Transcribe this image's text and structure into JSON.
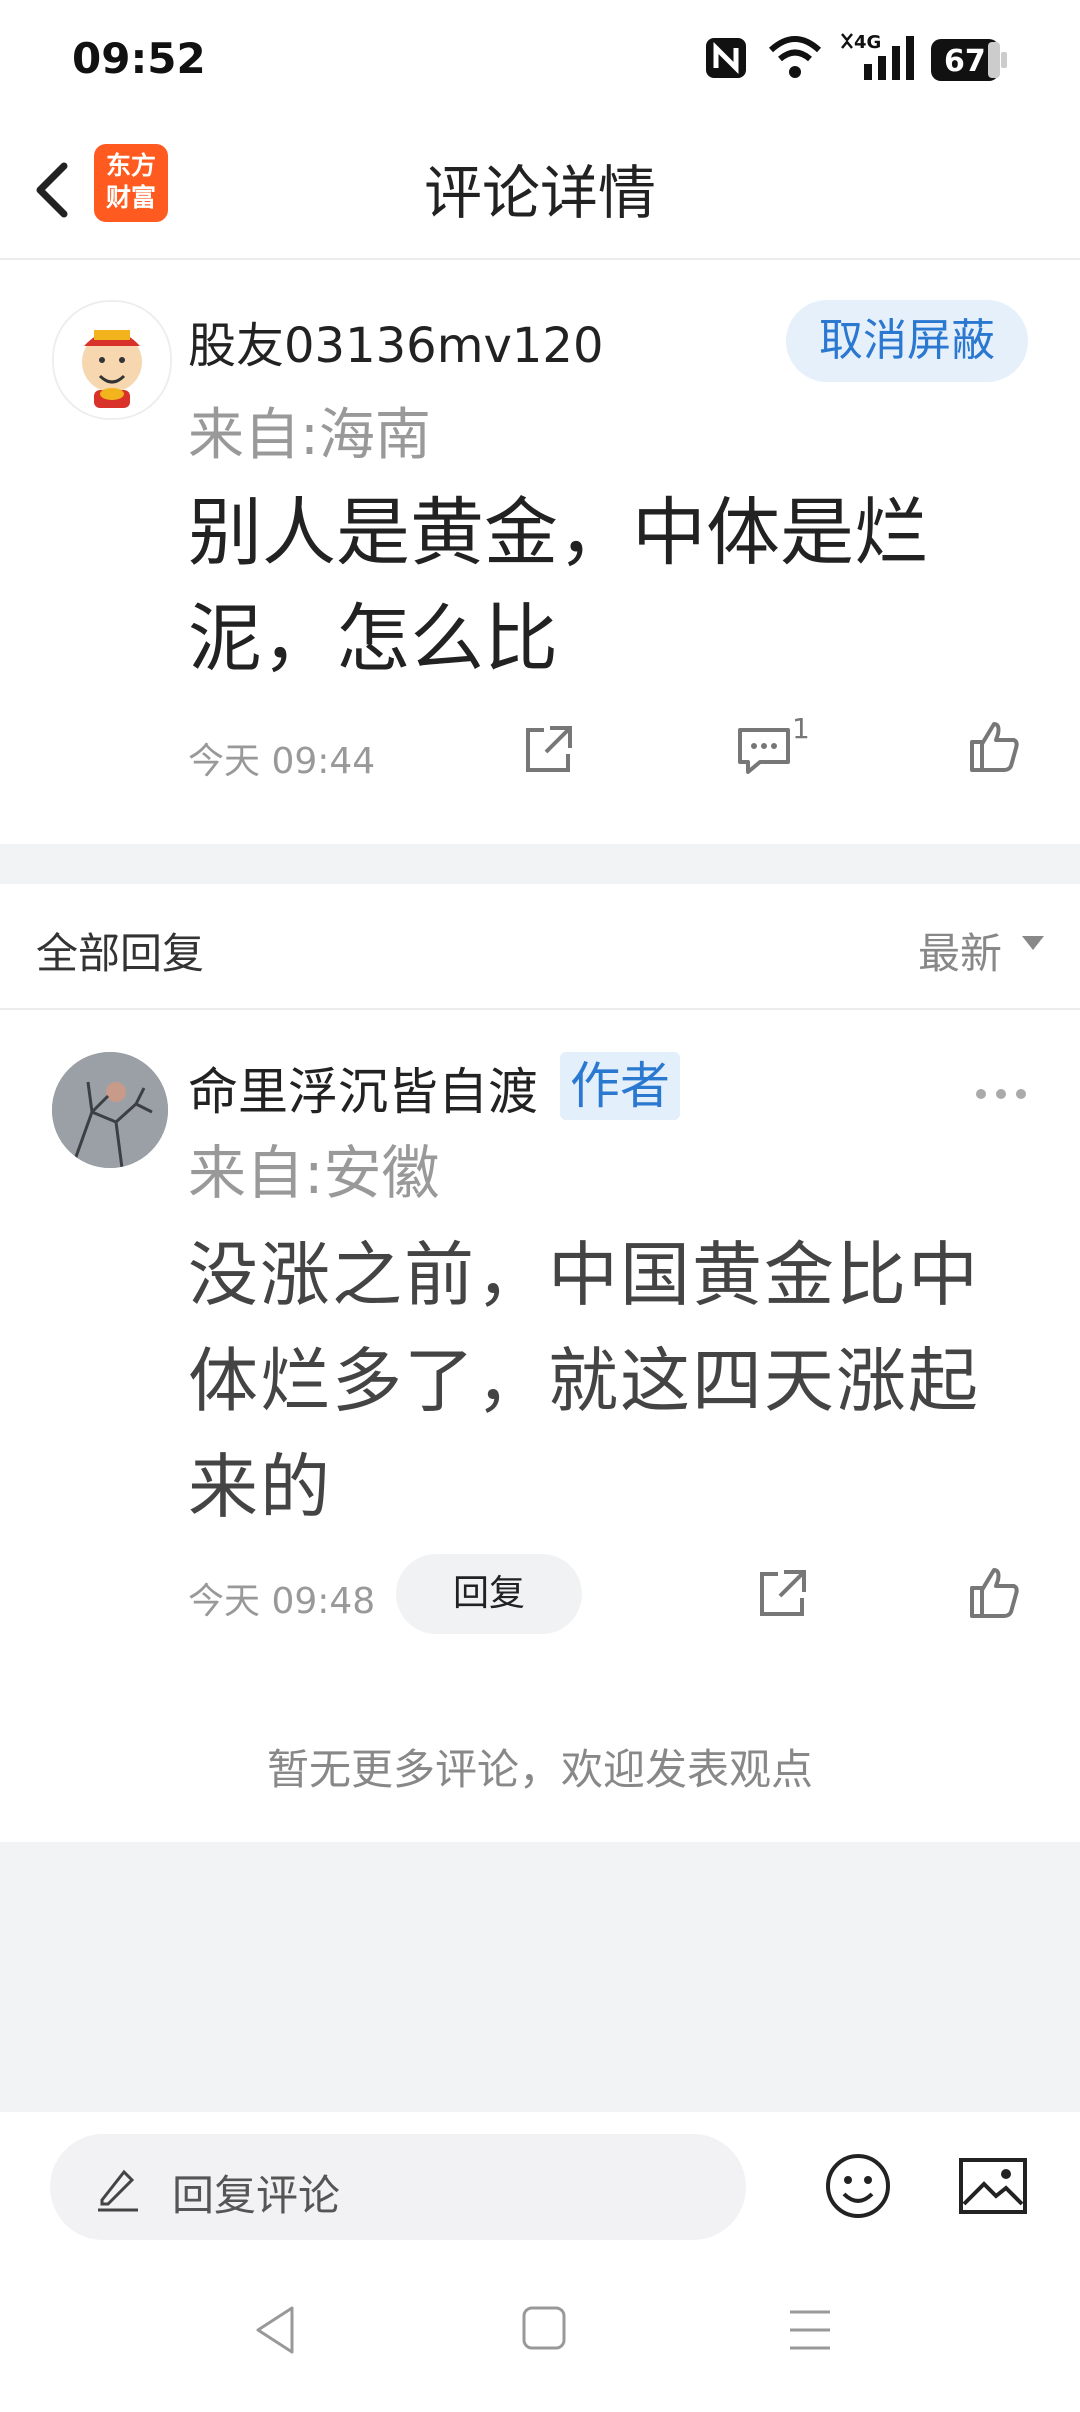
{
  "status_bar": {
    "time": "09:52",
    "icons": [
      "nfc-icon",
      "wifi-icon",
      "signal-4g-icon",
      "battery-icon"
    ],
    "battery": "67"
  },
  "nav": {
    "back_icon": "chevron-left-icon",
    "logo_text_line1": "东方",
    "logo_text_line2": "财富",
    "title": "评论详情"
  },
  "main_comment": {
    "username": "股友03136mv120",
    "from": "来自:海南",
    "content": "别人是黄金，中体是烂泥，怎么比",
    "time": "今天 09:44",
    "unblock_label": "取消屏蔽",
    "comment_count": "1"
  },
  "replies": {
    "header_label": "全部回复",
    "sort_label": "最新",
    "items": [
      {
        "username": "命里浮沉皆自渡",
        "badge": "作者",
        "from": "来自:安徽",
        "content": "没涨之前，中国黄金比中体烂多了，就这四天涨起来的",
        "time": "今天 09:48",
        "reply_label": "回复"
      }
    ],
    "no_more_text": "暂无更多评论，欢迎发表观点"
  },
  "bottom": {
    "input_placeholder": "回复评论"
  },
  "colors": {
    "accent_blue": "#2a78d0",
    "brand_orange": "#ff5a1f",
    "background_gray": "#f2f3f5"
  }
}
